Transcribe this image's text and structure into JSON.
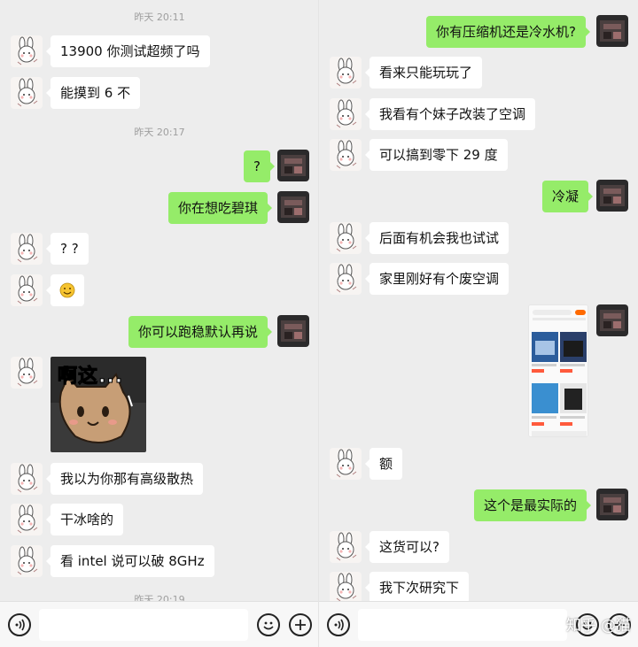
{
  "left": {
    "timestamps": [
      "昨天 20:11",
      "昨天 20:17",
      "昨天 20:19"
    ],
    "messages": [
      {
        "side": "in",
        "text": "13900 你测试超频了吗"
      },
      {
        "side": "in",
        "text": "能摸到 6 不"
      },
      {
        "side": "out",
        "text": "?"
      },
      {
        "side": "out",
        "text": "你在想吃碧琪"
      },
      {
        "side": "in",
        "text": "? ?"
      },
      {
        "side": "in",
        "emoji": "smile-emoji"
      },
      {
        "side": "out",
        "text": "你可以跑稳默认再说"
      },
      {
        "side": "in",
        "sticker": "cat-sticker",
        "sticker_text": "啊这..."
      },
      {
        "side": "in",
        "text": "我以为你那有高级散热"
      },
      {
        "side": "in",
        "text": "干冰啥的"
      },
      {
        "side": "in",
        "text": "看 intel 说可以破 8GHz"
      }
    ]
  },
  "right": {
    "messages": [
      {
        "side": "out",
        "text": "你有压缩机还是冷水机?"
      },
      {
        "side": "in",
        "text": "看来只能玩玩了"
      },
      {
        "side": "in",
        "text": "我看有个妹子改装了空调"
      },
      {
        "side": "in",
        "text": "可以搞到零下 29 度"
      },
      {
        "side": "out",
        "text": "冷凝"
      },
      {
        "side": "in",
        "text": "后面有机会我也试试"
      },
      {
        "side": "in",
        "text": "家里刚好有个废空调"
      },
      {
        "side": "out",
        "image": "shopping-screenshot"
      },
      {
        "side": "in",
        "text": "额"
      },
      {
        "side": "out",
        "text": "这个是最实际的"
      },
      {
        "side": "in",
        "text": "这货可以?"
      },
      {
        "side": "in",
        "text": "我下次研究下"
      }
    ]
  },
  "input_bar": {
    "voice_icon": "voice-icon",
    "emoji_icon": "emoji-icon",
    "plus_icon": "plus-icon"
  },
  "watermark": "知乎 @猫"
}
